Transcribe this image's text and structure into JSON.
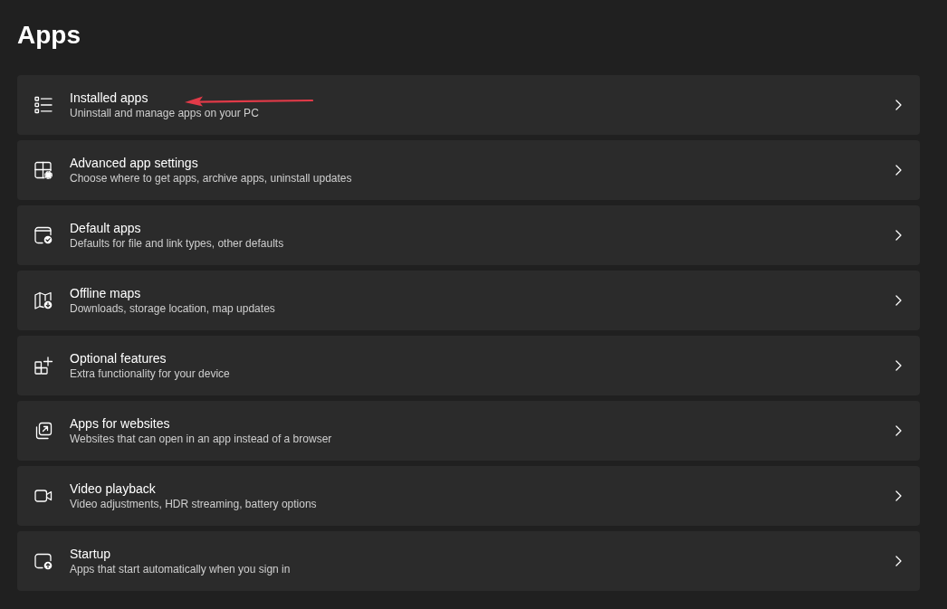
{
  "page": {
    "title": "Apps"
  },
  "items": [
    {
      "title": "Installed apps",
      "description": "Uninstall and manage apps on your PC",
      "arrow_annotation": true
    },
    {
      "title": "Advanced app settings",
      "description": "Choose where to get apps, archive apps, uninstall updates",
      "arrow_annotation": false
    },
    {
      "title": "Default apps",
      "description": "Defaults for file and link types, other defaults",
      "arrow_annotation": false
    },
    {
      "title": "Offline maps",
      "description": "Downloads, storage location, map updates",
      "arrow_annotation": false
    },
    {
      "title": "Optional features",
      "description": "Extra functionality for your device",
      "arrow_annotation": false
    },
    {
      "title": "Apps for websites",
      "description": "Websites that can open in an app instead of a browser",
      "arrow_annotation": false
    },
    {
      "title": "Video playback",
      "description": "Video adjustments, HDR streaming, battery options",
      "arrow_annotation": false
    },
    {
      "title": "Startup",
      "description": "Apps that start automatically when you sign in",
      "arrow_annotation": false
    }
  ]
}
